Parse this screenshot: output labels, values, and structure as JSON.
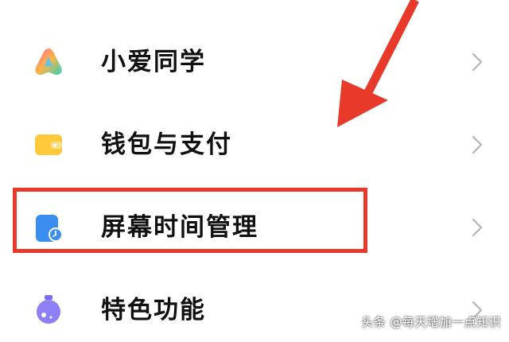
{
  "settings": {
    "items": [
      {
        "label": "小爱同学",
        "icon": "xiaoai-assistant-icon"
      },
      {
        "label": "钱包与支付",
        "icon": "wallet-icon"
      },
      {
        "label": "屏幕时间管理",
        "icon": "screen-time-icon"
      },
      {
        "label": "特色功能",
        "icon": "special-features-icon"
      }
    ],
    "chevron_icon": "chevron-right-icon"
  },
  "annotation": {
    "highlight_color": "#e8392a",
    "highlighted_item": "屏幕时间管理"
  },
  "watermark": "头条 @每天增加一点知识"
}
